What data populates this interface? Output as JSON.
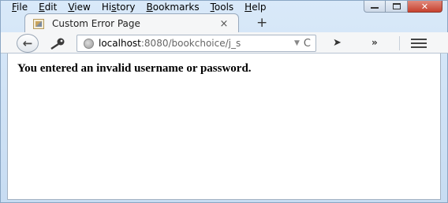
{
  "menu": {
    "items": [
      {
        "underline": "F",
        "rest": "ile"
      },
      {
        "underline": "E",
        "rest": "dit"
      },
      {
        "underline": "V",
        "rest": "iew"
      },
      {
        "prefix": "Hi",
        "underline": "s",
        "rest": "tory"
      },
      {
        "underline": "B",
        "rest": "ookmarks"
      },
      {
        "underline": "T",
        "rest": "ools"
      },
      {
        "underline": "H",
        "rest": "elp"
      }
    ]
  },
  "window_controls": {
    "minimize": "minimize-icon",
    "maximize": "maximize-icon",
    "close": "close-icon",
    "close_color": "#c7412e"
  },
  "tab": {
    "title": "Custom Error Page",
    "close_glyph": "×",
    "new_tab_glyph": "+"
  },
  "navbar": {
    "url_host": "localhost",
    "url_rest": ":8080/bookchoice/j_s",
    "dropmarker": "▼",
    "reload": "C",
    "send_glyph": "➤",
    "overflow_glyph": "»"
  },
  "page": {
    "message": "You entered an invalid username or password."
  }
}
